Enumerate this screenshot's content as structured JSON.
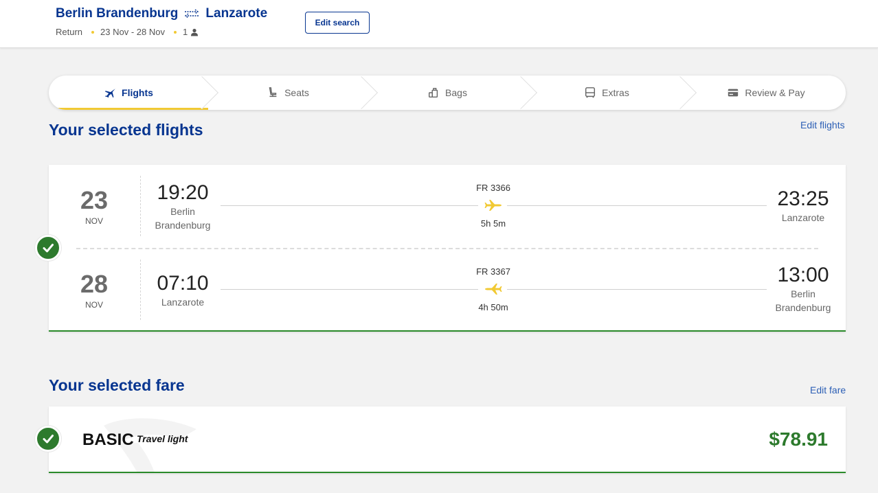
{
  "header": {
    "origin": "Berlin Brandenburg",
    "destination": "Lanzarote",
    "trip_type": "Return",
    "dates": "23 Nov - 28 Nov",
    "passengers": "1",
    "edit_search_label": "Edit search",
    "accent_color": "#073590",
    "dot_color": "#f1c933"
  },
  "stepper": {
    "steps": [
      {
        "label": "Flights",
        "icon": "plane-icon",
        "active": true
      },
      {
        "label": "Seats",
        "icon": "seat-icon",
        "active": false
      },
      {
        "label": "Bags",
        "icon": "bag-icon",
        "active": false
      },
      {
        "label": "Extras",
        "icon": "bus-icon",
        "active": false
      },
      {
        "label": "Review & Pay",
        "icon": "card-icon",
        "active": false
      }
    ]
  },
  "flights_section": {
    "title": "Your selected flights",
    "edit_label": "Edit flights",
    "flights": [
      {
        "day": "23",
        "month": "NOV",
        "dep_time": "19:20",
        "dep_city_line1": "Berlin",
        "dep_city_line2": "Brandenburg",
        "flight_number": "FR 3366",
        "duration": "5h 5m",
        "arr_time": "23:25",
        "arr_city_line1": "Lanzarote",
        "arr_city_line2": ""
      },
      {
        "day": "28",
        "month": "NOV",
        "dep_time": "07:10",
        "dep_city_line1": "Lanzarote",
        "dep_city_line2": "",
        "flight_number": "FR 3367",
        "duration": "4h 50m",
        "arr_time": "13:00",
        "arr_city_line1": "Berlin",
        "arr_city_line2": "Brandenburg"
      }
    ]
  },
  "fare_section": {
    "title": "Your selected fare",
    "edit_label": "Edit fare",
    "fare_name": "BASIC",
    "fare_subtitle": "Travel light",
    "price": "$78.91",
    "price_color": "#2d7a2d"
  }
}
